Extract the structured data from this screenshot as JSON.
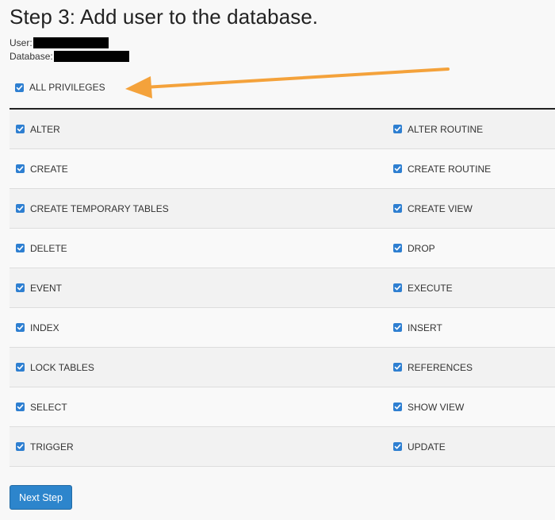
{
  "page": {
    "title": "Step 3: Add user to the database.",
    "user_label": "User:",
    "database_label": "Database:"
  },
  "all_privileges": {
    "label": "ALL PRIVILEGES",
    "checked": true
  },
  "privileges": [
    {
      "left": "ALTER",
      "right": "ALTER ROUTINE"
    },
    {
      "left": "CREATE",
      "right": "CREATE ROUTINE"
    },
    {
      "left": "CREATE TEMPORARY TABLES",
      "right": "CREATE VIEW"
    },
    {
      "left": "DELETE",
      "right": "DROP"
    },
    {
      "left": "EVENT",
      "right": "EXECUTE"
    },
    {
      "left": "INDEX",
      "right": "INSERT"
    },
    {
      "left": "LOCK TABLES",
      "right": "REFERENCES"
    },
    {
      "left": "SELECT",
      "right": "SHOW VIEW"
    },
    {
      "left": "TRIGGER",
      "right": "UPDATE"
    }
  ],
  "next_button": {
    "label": "Next Step"
  },
  "colors": {
    "checkbox": "#2e7fd1",
    "arrow": "#f4a23b",
    "button": "#2d85cc"
  }
}
